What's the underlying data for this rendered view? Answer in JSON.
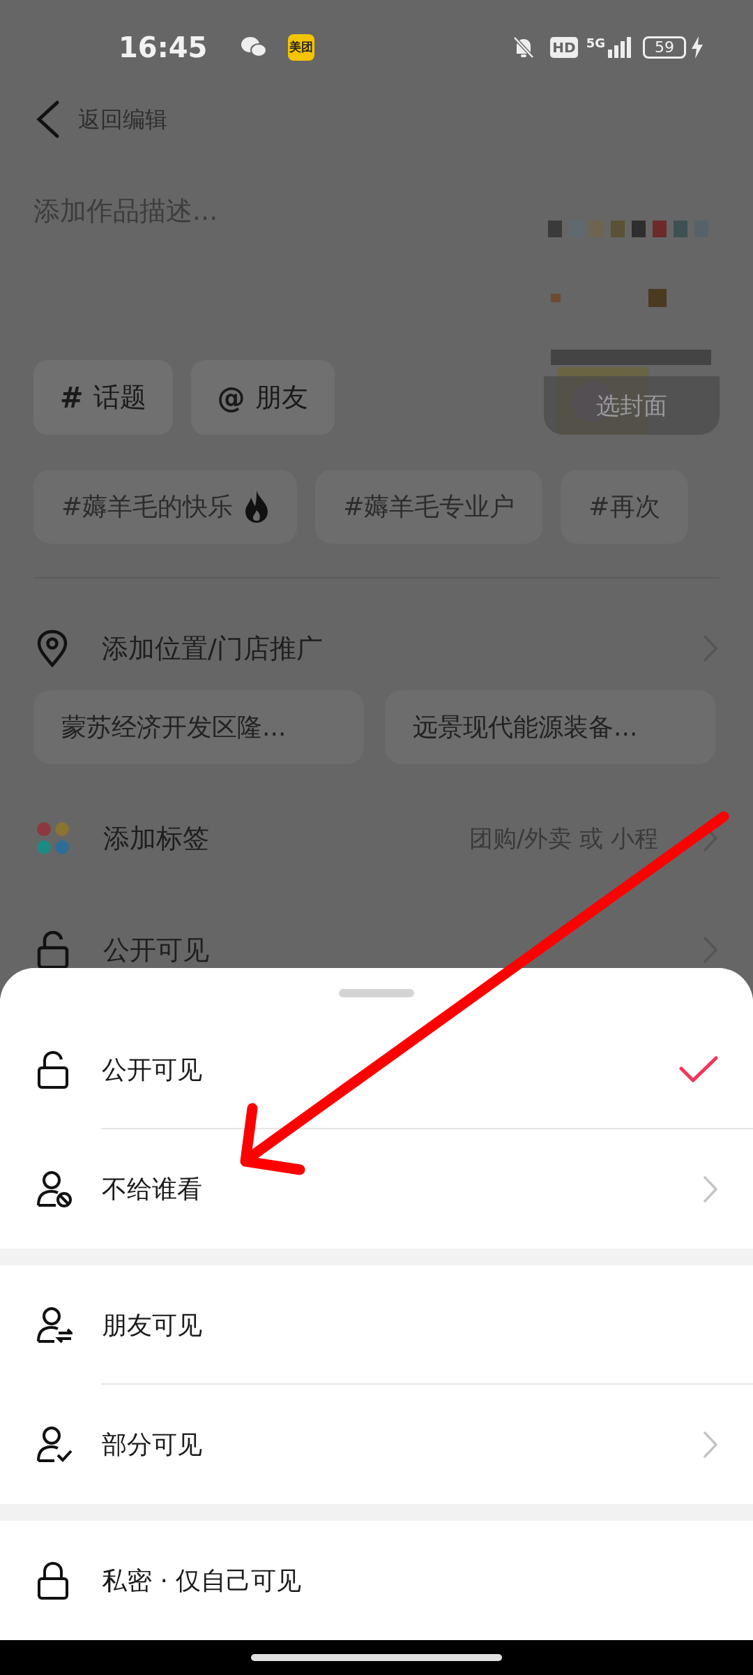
{
  "status_bar": {
    "time": "16:45",
    "app_badge": "美团",
    "hd_badge": "HD",
    "network": "5G",
    "battery": "59"
  },
  "header": {
    "back_label": "返回编辑"
  },
  "description": {
    "placeholder": "添加作品描述..."
  },
  "cover": {
    "label": "选封面"
  },
  "insert_buttons": [
    {
      "symbol": "#",
      "label": "话题"
    },
    {
      "symbol": "@",
      "label": "朋友"
    }
  ],
  "topic_suggestions": [
    {
      "label": "#薅羊毛的快乐",
      "hot": true
    },
    {
      "label": "#薅羊毛专业户",
      "hot": false
    },
    {
      "label": "#再次",
      "hot": false
    }
  ],
  "location": {
    "label": "添加位置/门店推广",
    "suggestions": [
      "蒙苏经济开发区隆...",
      "远景现代能源装备..."
    ]
  },
  "tag_row": {
    "label": "添加标签",
    "hint": "团购/外卖 或 小程"
  },
  "visibility_row": {
    "label": "公开可见"
  },
  "sheet": {
    "groups": [
      [
        {
          "kind": "public",
          "label": "公开可见",
          "selected": true,
          "chevron": false
        },
        {
          "kind": "exclude",
          "label": "不给谁看",
          "selected": false,
          "chevron": true
        }
      ],
      [
        {
          "kind": "friends",
          "label": "朋友可见",
          "selected": false,
          "chevron": false
        },
        {
          "kind": "partial",
          "label": "部分可见",
          "selected": false,
          "chevron": true
        }
      ],
      [
        {
          "kind": "private",
          "label": "私密 · 仅自己可见",
          "selected": false,
          "chevron": false
        }
      ]
    ]
  }
}
